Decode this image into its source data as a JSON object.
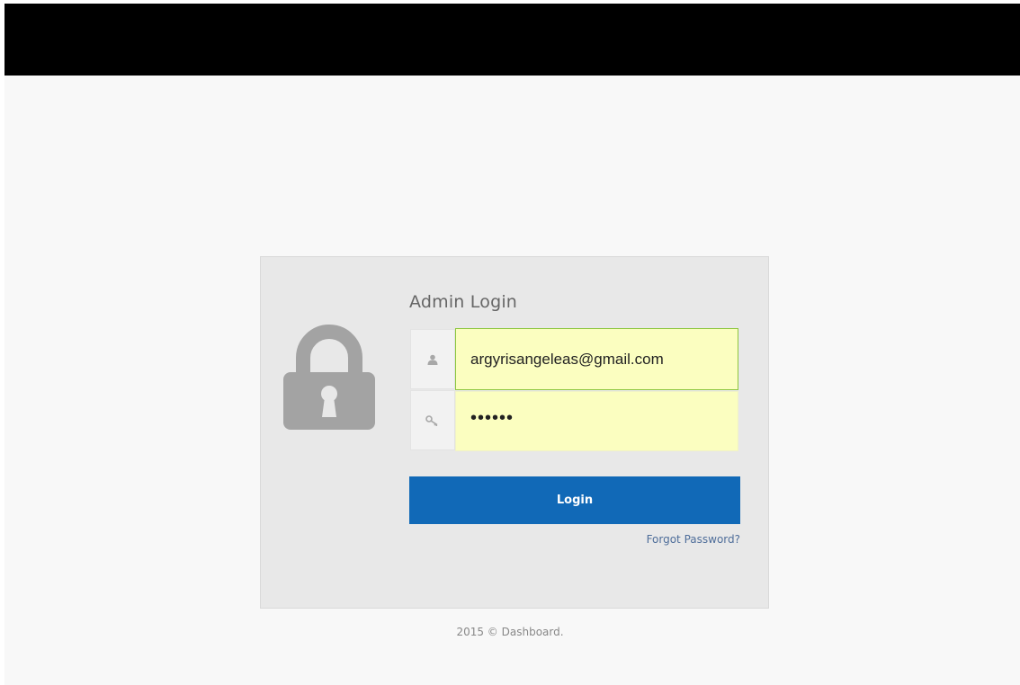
{
  "login": {
    "title": "Admin Login",
    "email_value": "argyrisangeleas@gmail.com",
    "password_value": "••••••",
    "login_button_label": "Login",
    "forgot_password_label": "Forgot Password?"
  },
  "footer": {
    "text": "2015 © Dashboard."
  },
  "icons": {
    "lock": "padlock-icon",
    "user": "user-icon",
    "key": "key-icon"
  },
  "colors": {
    "primary_button": "#1169b7",
    "input_autofill": "#fbfec0",
    "input_focus_border": "#8cc63f",
    "top_bar": "#000000"
  }
}
